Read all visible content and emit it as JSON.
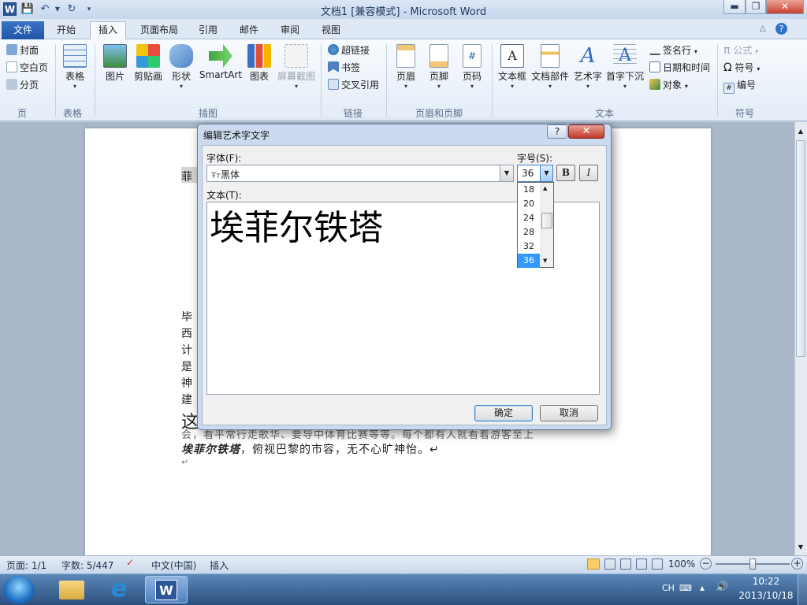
{
  "window": {
    "title": "文档1 [兼容模式] - Microsoft Word",
    "logo_letter": "W",
    "min": "▬",
    "max": "❐",
    "close": "✕"
  },
  "tabs": {
    "file": "文件",
    "items": [
      "开始",
      "插入",
      "页面布局",
      "引用",
      "邮件",
      "审阅",
      "视图"
    ]
  },
  "ribbon": {
    "pages": {
      "cover": "封面",
      "blank": "空白页",
      "break": "分页",
      "label": "页"
    },
    "tables": {
      "table": "表格",
      "label": "表格"
    },
    "illustrations": {
      "picture": "图片",
      "clipart": "剪贴画",
      "shapes": "形状",
      "smartart": "SmartArt",
      "chart": "图表",
      "screenshot": "屏幕截图",
      "label": "插图"
    },
    "links": {
      "hyperlink": "超链接",
      "bookmark": "书签",
      "crossref": "交叉引用",
      "label": "链接"
    },
    "headerfooter": {
      "header": "页眉",
      "footer": "页脚",
      "pagenum": "页码",
      "label": "页眉和页脚"
    },
    "text": {
      "textbox": "文本框",
      "parts": "文档部件",
      "wordart": "艺术字",
      "dropcap": "首字下沉",
      "sigline": "签名行",
      "datetime": "日期和时间",
      "object": "对象",
      "label": "文本"
    },
    "symbols": {
      "equation": "公式",
      "symbol": "符号",
      "number": "编号",
      "label": "符号"
    }
  },
  "document": {
    "line1": "菲",
    "para": [
      "毕",
      "西",
      "计",
      "是",
      "神",
      "建"
    ],
    "line_big": "这",
    "line_a": "会，看平常行走歌华、要导中体育比赛等等。每个都有人就看着游客至上",
    "bold_name": "埃菲尔铁塔",
    "line_b": "，俯视巴黎的市容，无不心旷神怡。↵",
    "para_mark": "↵"
  },
  "dialog": {
    "title": "编辑艺术字文字",
    "help": "?",
    "close": "✕",
    "font_label": "字体(F):",
    "font_value": "黑体",
    "font_icon": "Ŧт",
    "size_label": "字号(S):",
    "size_value": "36",
    "bold": "B",
    "italic": "I",
    "size_options": [
      "18",
      "20",
      "24",
      "28",
      "32",
      "36"
    ],
    "text_label": "文本(T):",
    "text_value": "埃菲尔铁塔",
    "ok": "确定",
    "cancel": "取消"
  },
  "status": {
    "page": "页面: 1/1",
    "words": "字数: 5/447",
    "lang": "中文(中国)",
    "mode": "插入",
    "zoom": "100%"
  },
  "tray": {
    "ime": "CH",
    "time": "10:22",
    "date": "2013/10/18"
  }
}
